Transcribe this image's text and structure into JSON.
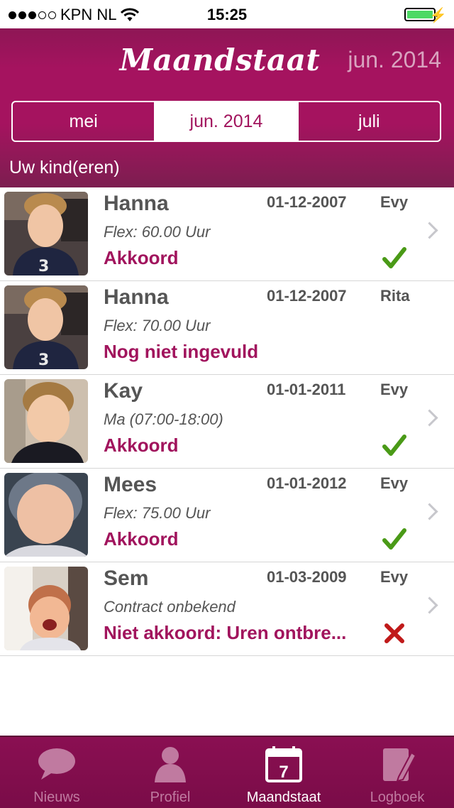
{
  "status_bar": {
    "carrier": "KPN NL",
    "time": "15:25"
  },
  "header": {
    "title": "Maandstaat",
    "current_month": "jun. 2014",
    "segments": [
      {
        "label": "mei",
        "active": false
      },
      {
        "label": "jun. 2014",
        "active": true
      },
      {
        "label": "juli",
        "active": false
      }
    ],
    "section_label": "Uw kind(eren)"
  },
  "children": [
    {
      "name": "Hanna",
      "dob": "01-12-2007",
      "carer": "Evy",
      "detail": "Flex: 60.00 Uur",
      "status": "Akkoord",
      "mark": "check",
      "chevron": true
    },
    {
      "name": "Hanna",
      "dob": "01-12-2007",
      "carer": "Rita",
      "detail": "Flex: 70.00 Uur",
      "status": "Nog niet ingevuld",
      "mark": "none",
      "chevron": false
    },
    {
      "name": "Kay",
      "dob": "01-01-2011",
      "carer": "Evy",
      "detail": "Ma (07:00-18:00)",
      "status": "Akkoord",
      "mark": "check",
      "chevron": true
    },
    {
      "name": "Mees",
      "dob": "01-01-2012",
      "carer": "Evy",
      "detail": "Flex: 75.00 Uur",
      "status": "Akkoord",
      "mark": "check",
      "chevron": true
    },
    {
      "name": "Sem",
      "dob": "01-03-2009",
      "carer": "Evy",
      "detail": "Contract onbekend",
      "status": "Niet akkoord: Uren ontbre...",
      "mark": "cross",
      "chevron": true
    }
  ],
  "tabbar": {
    "tabs": [
      {
        "label": "Nieuws",
        "icon": "speech-bubble-icon",
        "active": false
      },
      {
        "label": "Profiel",
        "icon": "person-icon",
        "active": false
      },
      {
        "label": "Maandstaat",
        "icon": "calendar-icon",
        "active": true,
        "icon_text": "7"
      },
      {
        "label": "Logboek",
        "icon": "notebook-pencil-icon",
        "active": false
      }
    ]
  },
  "colors": {
    "brand": "#a1145d",
    "check": "#4a9a17",
    "cross": "#c01a1a",
    "tab_bg": "#86104f"
  }
}
